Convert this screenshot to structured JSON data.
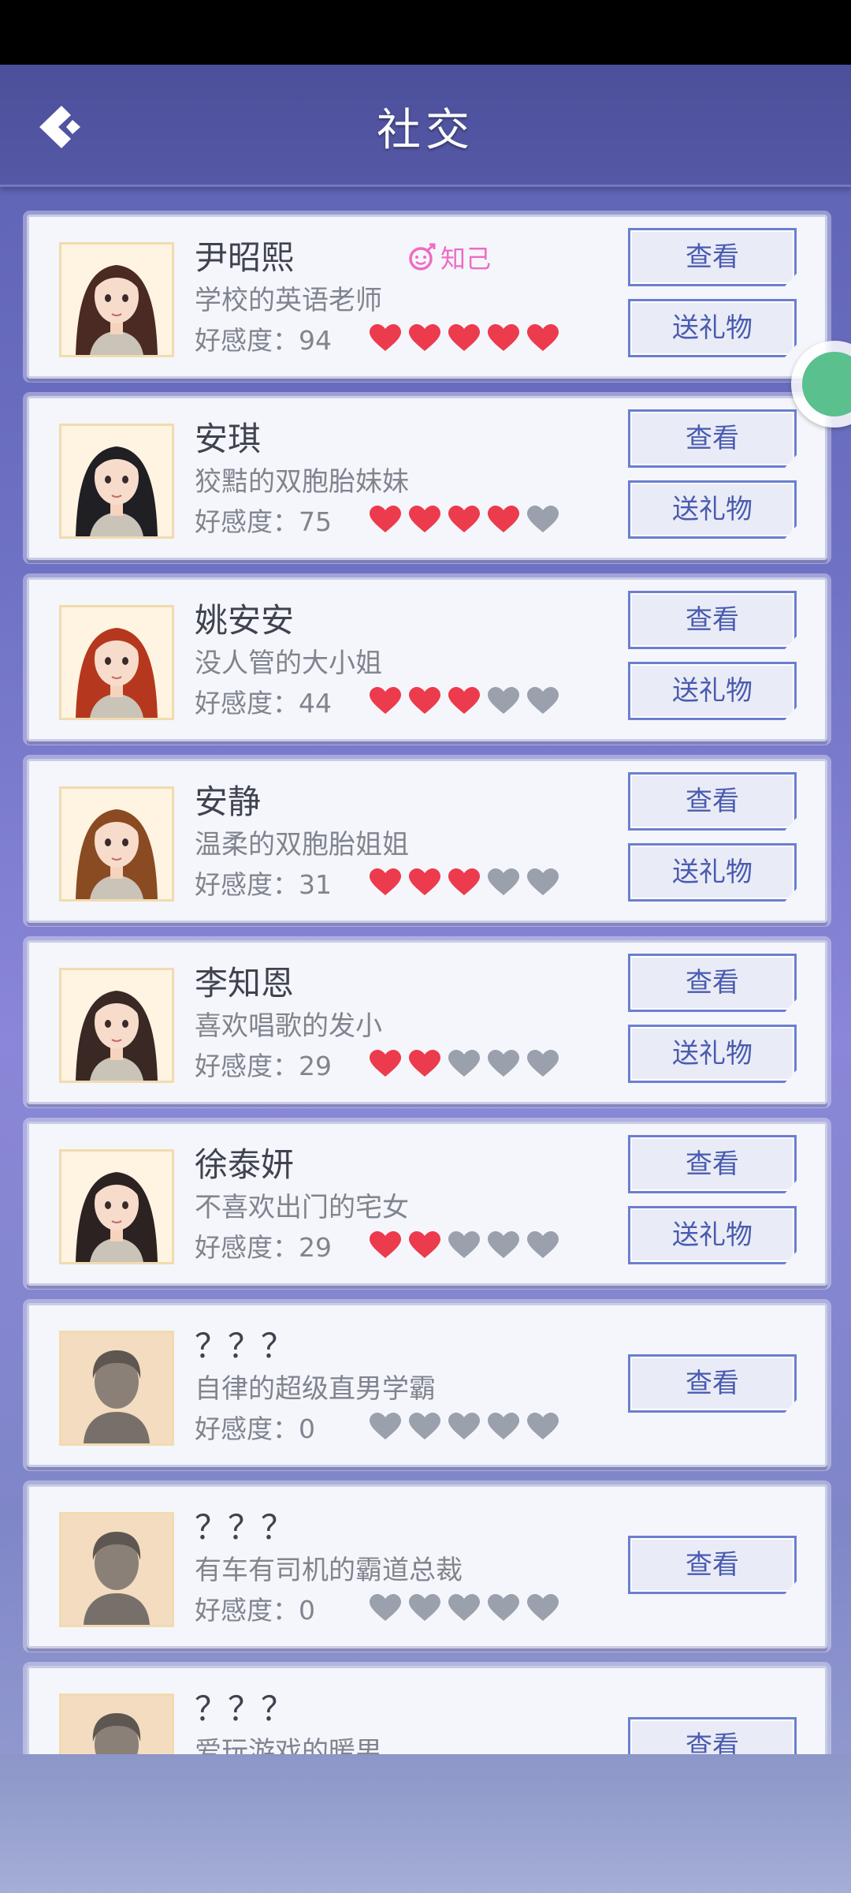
{
  "header": {
    "title": "社交"
  },
  "labels": {
    "affinity_prefix": "好感度：",
    "view": "查看",
    "gift": "送礼物"
  },
  "colors": {
    "heart_on": "#ec3b4d",
    "heart_off": "#9aa0ac",
    "badge": "#ef6bc3",
    "button_text": "#4a5bb0"
  },
  "characters": [
    {
      "name": "尹昭熙",
      "desc": "学校的英语老师",
      "affinity": "好感度：94",
      "hearts": 5,
      "badge": "知己",
      "has_gift": true,
      "avatar": "teacher-avatar"
    },
    {
      "name": "安琪",
      "desc": "狡黠的双胞胎妹妹",
      "affinity": "好感度：75",
      "hearts": 4,
      "has_gift": true,
      "avatar": "twin-sister-avatar"
    },
    {
      "name": "姚安安",
      "desc": "没人管的大小姐",
      "affinity": "好感度：44",
      "hearts": 3,
      "has_gift": true,
      "avatar": "rich-girl-avatar"
    },
    {
      "name": "安静",
      "desc": "温柔的双胞胎姐姐",
      "affinity": "好感度：31",
      "hearts": 3,
      "has_gift": true,
      "avatar": "twin-elder-avatar"
    },
    {
      "name": "李知恩",
      "desc": "喜欢唱歌的发小",
      "affinity": "好感度：29",
      "hearts": 2,
      "has_gift": true,
      "avatar": "singer-avatar"
    },
    {
      "name": "徐泰妍",
      "desc": "不喜欢出门的宅女",
      "affinity": "好感度：29",
      "hearts": 2,
      "has_gift": true,
      "avatar": "homebody-avatar"
    },
    {
      "name": "？？？",
      "desc": "自律的超级直男学霸",
      "affinity": "好感度：0",
      "hearts": 0,
      "has_gift": false,
      "avatar": "unknown-silhouette-avatar"
    },
    {
      "name": "？？？",
      "desc": "有车有司机的霸道总裁",
      "affinity": "好感度：0",
      "hearts": 0,
      "has_gift": false,
      "avatar": "unknown-silhouette-avatar"
    },
    {
      "name": "？？？",
      "desc": "爱玩游戏的暖男",
      "affinity": "",
      "hearts": 0,
      "has_gift": false,
      "avatar": "unknown-silhouette-avatar"
    }
  ]
}
